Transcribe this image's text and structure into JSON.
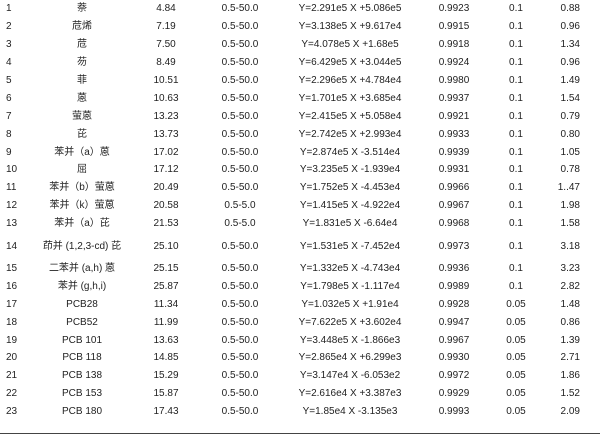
{
  "table": {
    "rows": [
      [
        "1",
        "萘",
        "4.84",
        "0.5-50.0",
        "Y=2.291e5 X +5.086e5",
        "0.9923",
        "0.1",
        "0.88"
      ],
      [
        "2",
        "苊烯",
        "7.19",
        "0.5-50.0",
        "Y=3.138e5 X +9.617e4",
        "0.9915",
        "0.1",
        "0.96"
      ],
      [
        "3",
        "苊",
        "7.50",
        "0.5-50.0",
        "Y=4.078e5 X +1.68e5",
        "0.9918",
        "0.1",
        "1.34"
      ],
      [
        "4",
        "芴",
        "8.49",
        "0.5-50.0",
        "Y=6.429e5 X +3.044e5",
        "0.9924",
        "0.1",
        "0.96"
      ],
      [
        "5",
        "菲",
        "10.51",
        "0.5-50.0",
        "Y=2.296e5 X +4.784e4",
        "0.9980",
        "0.1",
        "1.49"
      ],
      [
        "6",
        "蒽",
        "10.63",
        "0.5-50.0",
        "Y=1.701e5 X +3.685e4",
        "0.9937",
        "0.1",
        "1.54"
      ],
      [
        "7",
        "萤蒽",
        "13.23",
        "0.5-50.0",
        "Y=2.415e5 X +5.058e4",
        "0.9921",
        "0.1",
        "0.79"
      ],
      [
        "8",
        "芘",
        "13.73",
        "0.5-50.0",
        "Y=2.742e5 X +2.993e4",
        "0.9933",
        "0.1",
        "0.80"
      ],
      [
        "9",
        "苯并（a）蒽",
        "17.02",
        "0.5-50.0",
        "Y=2.874e5 X -3.514e4",
        "0.9939",
        "0.1",
        "1.05"
      ],
      [
        "10",
        "屈",
        "17.12",
        "0.5-50.0",
        "Y=3.235e5 X -1.939e4",
        "0.9931",
        "0.1",
        "0.78"
      ],
      [
        "11",
        "苯并（b）萤蒽",
        "20.49",
        "0.5-50.0",
        "Y=1.752e5 X -4.453e4",
        "0.9966",
        "0.1",
        "1..47"
      ],
      [
        "12",
        "苯并（k）萤蒽",
        "20.58",
        "0.5-5.0",
        "Y=1.415e5 X -4.922e4",
        "0.9967",
        "0.1",
        "1.98"
      ],
      [
        "13",
        "苯并（a）芘",
        "21.53",
        "0.5-5.0",
        "Y=1.831e5 X -6.64e4",
        "0.9968",
        "0.1",
        "1.58"
      ],
      [
        "14",
        "茚并 (1,2,3-cd) 芘",
        "25.10",
        "0.5-50.0",
        "Y=1.531e5 X -7.452e4",
        "0.9973",
        "0.1",
        "3.18"
      ],
      [
        "15",
        "二苯并 (a,h) 蒽",
        "25.15",
        "0.5-50.0",
        "Y=1.332e5 X -4.743e4",
        "0.9936",
        "0.1",
        "3.23"
      ],
      [
        "16",
        "苯并 (g,h,i)",
        "25.87",
        "0.5-50.0",
        "Y=1.798e5 X -1.117e4",
        "0.9989",
        "0.1",
        "2.82"
      ],
      [
        "17",
        "PCB28",
        "11.34",
        "0.5-50.0",
        "Y=1.032e5 X +1.91e4",
        "0.9928",
        "0.05",
        "1.48"
      ],
      [
        "18",
        "PCB52",
        "11.99",
        "0.5-50.0",
        "Y=7.622e5 X +3.602e4",
        "0.9947",
        "0.05",
        "0.86"
      ],
      [
        "19",
        "PCB 101",
        "13.63",
        "0.5-50.0",
        "Y=3.448e5 X -1.866e3",
        "0.9967",
        "0.05",
        "1.39"
      ],
      [
        "20",
        "PCB 118",
        "14.85",
        "0.5-50.0",
        "Y=2.865e4 X +6.299e3",
        "0.9930",
        "0.05",
        "2.71"
      ],
      [
        "21",
        "PCB 138",
        "15.29",
        "0.5-50.0",
        "Y=3.147e4 X -6.053e2",
        "0.9972",
        "0.05",
        "1.86"
      ],
      [
        "22",
        "PCB 153",
        "15.87",
        "0.5-50.0",
        "Y=2.616e4 X +3.387e3",
        "0.9929",
        "0.05",
        "1.52"
      ],
      [
        "23",
        "PCB 180",
        "17.43",
        "0.5-50.0",
        "Y=1.85e4 X -3.135e3",
        "0.9993",
        "0.05",
        "2.09"
      ]
    ]
  }
}
